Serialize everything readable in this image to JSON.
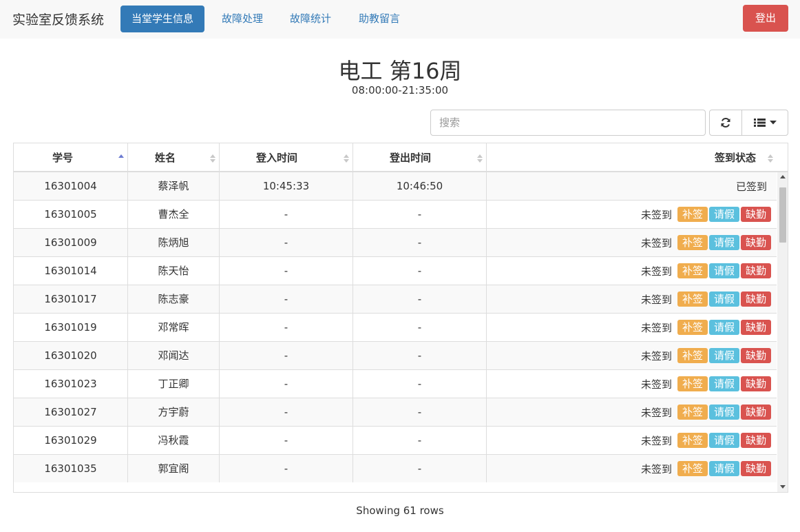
{
  "nav": {
    "brand": "实验室反馈系统",
    "items": [
      {
        "label": "当堂学生信息",
        "active": true
      },
      {
        "label": "故障处理",
        "active": false
      },
      {
        "label": "故障统计",
        "active": false
      },
      {
        "label": "助教留言",
        "active": false
      }
    ],
    "logout_label": "登出"
  },
  "header": {
    "title": "电工 第16周",
    "time_range": "08:00:00-21:35:00"
  },
  "toolbar": {
    "search_placeholder": "搜索",
    "refresh_icon": "refresh-icon",
    "columns_icon": "list-icon"
  },
  "table": {
    "columns": [
      "学号",
      "姓名",
      "登入时间",
      "登出时间",
      "签到状态"
    ],
    "sorted_column": "学号",
    "sort_direction": "asc",
    "rows": [
      {
        "id": "16301004",
        "name": "蔡泽帆",
        "login": "10:45:33",
        "logout": "10:46:50",
        "status": "已签到",
        "actions": []
      },
      {
        "id": "16301005",
        "name": "曹杰全",
        "login": "-",
        "logout": "-",
        "status": "未签到",
        "actions": [
          "补签",
          "请假",
          "缺勤"
        ]
      },
      {
        "id": "16301009",
        "name": "陈炳旭",
        "login": "-",
        "logout": "-",
        "status": "未签到",
        "actions": [
          "补签",
          "请假",
          "缺勤"
        ]
      },
      {
        "id": "16301014",
        "name": "陈天怡",
        "login": "-",
        "logout": "-",
        "status": "未签到",
        "actions": [
          "补签",
          "请假",
          "缺勤"
        ]
      },
      {
        "id": "16301017",
        "name": "陈志豪",
        "login": "-",
        "logout": "-",
        "status": "未签到",
        "actions": [
          "补签",
          "请假",
          "缺勤"
        ]
      },
      {
        "id": "16301019",
        "name": "邓常晖",
        "login": "-",
        "logout": "-",
        "status": "未签到",
        "actions": [
          "补签",
          "请假",
          "缺勤"
        ]
      },
      {
        "id": "16301020",
        "name": "邓闻达",
        "login": "-",
        "logout": "-",
        "status": "未签到",
        "actions": [
          "补签",
          "请假",
          "缺勤"
        ]
      },
      {
        "id": "16301023",
        "name": "丁正卿",
        "login": "-",
        "logout": "-",
        "status": "未签到",
        "actions": [
          "补签",
          "请假",
          "缺勤"
        ]
      },
      {
        "id": "16301027",
        "name": "方宇蔚",
        "login": "-",
        "logout": "-",
        "status": "未签到",
        "actions": [
          "补签",
          "请假",
          "缺勤"
        ]
      },
      {
        "id": "16301029",
        "name": "冯秋霞",
        "login": "-",
        "logout": "-",
        "status": "未签到",
        "actions": [
          "补签",
          "请假",
          "缺勤"
        ]
      },
      {
        "id": "16301035",
        "name": "郭宜阁",
        "login": "-",
        "logout": "-",
        "status": "未签到",
        "actions": [
          "补签",
          "请假",
          "缺勤"
        ]
      }
    ]
  },
  "footer": {
    "summary": "Showing 61 rows"
  },
  "colors": {
    "primary": "#337ab7",
    "danger": "#d9534f",
    "warning": "#f0ad4e",
    "info": "#5bc0de"
  }
}
